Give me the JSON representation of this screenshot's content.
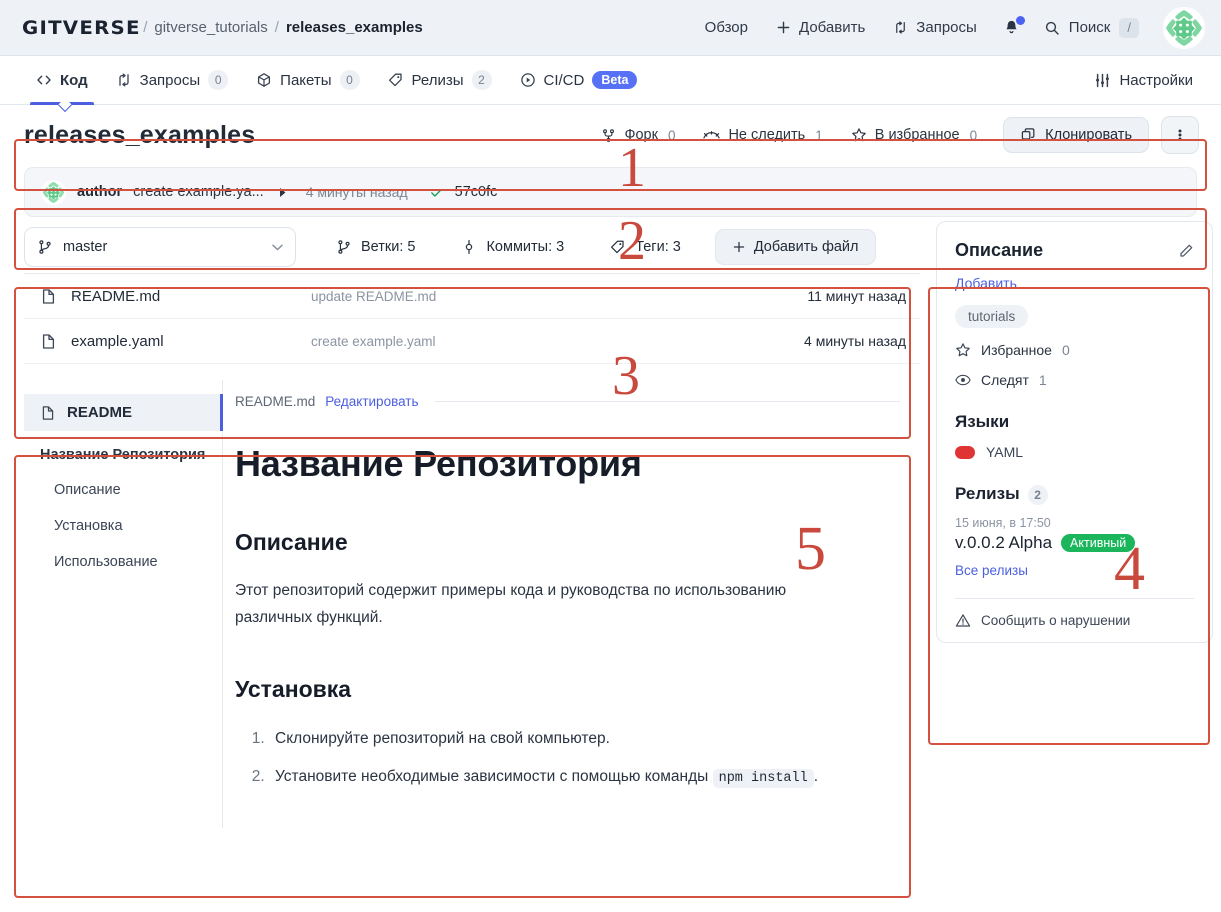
{
  "header": {
    "brand": "GITVERSE",
    "separator": "/",
    "org": "gitverse_tutorials",
    "repo": "releases_examples",
    "nav": [
      {
        "label": "Обзор",
        "icon": "none"
      },
      {
        "label": "Добавить",
        "icon": "plus-icon"
      },
      {
        "label": "Запросы",
        "icon": "pull-request-icon"
      }
    ],
    "notifications_icon": "bell-icon",
    "search": {
      "label": "Поиск",
      "shortcut": "/"
    },
    "avatar_icon": "user-avatar"
  },
  "tabs": {
    "items": [
      {
        "label": "Код",
        "icon": "code-icon",
        "badge": "",
        "active": true
      },
      {
        "label": "Запросы",
        "icon": "pull-request-icon",
        "badge": "0",
        "active": false
      },
      {
        "label": "Пакеты",
        "icon": "package-icon",
        "badge": "0",
        "active": false
      },
      {
        "label": "Релизы",
        "icon": "tag-icon",
        "badge": "2",
        "active": false
      },
      {
        "label": "CI/CD",
        "icon": "play-circle-icon",
        "badge": "Beta",
        "active": false
      }
    ],
    "settings": {
      "label": "Настройки",
      "icon": "sliders-icon"
    }
  },
  "repo_header": {
    "title": "releases_examples",
    "actions": [
      {
        "label": "Форк",
        "count": "0",
        "icon": "fork-icon"
      },
      {
        "label": "Не следить",
        "count": "1",
        "icon": "unwatch-icon"
      },
      {
        "label": "В избранное",
        "count": "0",
        "icon": "star-icon"
      }
    ],
    "clone_button": {
      "label": "Клонировать",
      "icon": "copy-icon"
    },
    "kebab_icon": "kebab-menu-icon"
  },
  "commit_bar": {
    "author": "author",
    "message": "create example.ya...",
    "expand_icon": "triangle-right-icon",
    "time": "4 минуты назад",
    "status_icon": "check-icon",
    "sha": "57c0fc"
  },
  "file_toolbar": {
    "branch": "master",
    "branch_icon": "branch-icon",
    "branches": {
      "label": "Ветки: 5",
      "icon": "branch-icon"
    },
    "commits": {
      "label": "Коммиты: 3",
      "icon": "commit-icon"
    },
    "tags": {
      "label": "Теги: 3",
      "icon": "tag-icon"
    },
    "add_file": {
      "label": "Добавить файл",
      "icon": "plus-icon"
    }
  },
  "files": [
    {
      "name": "README.md",
      "icon": "file-icon",
      "message": "update README.md",
      "time": "11 минут назад"
    },
    {
      "name": "example.yaml",
      "icon": "file-icon",
      "message": "create example.yaml",
      "time": "4 минуты назад"
    }
  ],
  "readme": {
    "toc": {
      "root": {
        "label": "README",
        "icon": "file-icon"
      },
      "items": [
        {
          "label": "Название Репозитория",
          "level": 1
        },
        {
          "label": "Описание",
          "level": 2
        },
        {
          "label": "Установка",
          "level": 2
        },
        {
          "label": "Использование",
          "level": 2
        }
      ]
    },
    "file_label": "README.md",
    "edit_label": "Редактировать",
    "h1": "Название Репозитория",
    "section_description": {
      "heading": "Описание",
      "paragraph": "Этот репозиторий содержит примеры кода и руководства по использованию различных функций."
    },
    "section_install": {
      "heading": "Установка",
      "items": [
        {
          "text_before": "Склонируйте репозиторий на свой компьютер.",
          "code": "",
          "text_after": ""
        },
        {
          "text_before": "Установите необходимые зависимости с помощью команды ",
          "code": "npm install",
          "text_after": "."
        }
      ]
    }
  },
  "sidebar": {
    "description": {
      "title": "Описание",
      "edit_icon": "pencil-icon",
      "add_label": "Добавить"
    },
    "topic": "tutorials",
    "stats": [
      {
        "label": "Избранное",
        "value": "0",
        "icon": "star-icon"
      },
      {
        "label": "Следят",
        "value": "1",
        "icon": "eye-icon"
      }
    ],
    "languages": {
      "title": "Языки",
      "items": [
        {
          "name": "YAML",
          "color": "#e03434"
        }
      ]
    },
    "releases": {
      "title": "Релизы",
      "count": "2",
      "date": "15 июня, в 17:50",
      "name": "v.0.0.2 Alpha",
      "status": "Активный",
      "all_label": "Все релизы"
    },
    "report": {
      "label": "Сообщить о нарушении",
      "icon": "warning-icon"
    }
  },
  "annotations": {
    "color": "#c9493c",
    "numbers": [
      "1",
      "2",
      "3",
      "4",
      "5"
    ]
  }
}
